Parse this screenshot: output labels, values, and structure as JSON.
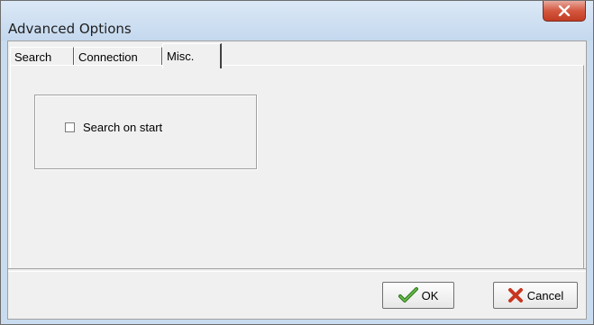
{
  "window": {
    "title": "Advanced Options",
    "close_label": "x"
  },
  "tabs": [
    {
      "label": "Search",
      "active": false
    },
    {
      "label": "Connection",
      "active": false
    },
    {
      "label": "Misc.",
      "active": true
    }
  ],
  "misc": {
    "search_on_start_label": "Search on start",
    "search_on_start_checked": false
  },
  "buttons": {
    "ok_label": "OK",
    "ok_icon": "checkmark-icon",
    "cancel_label": "Cancel",
    "cancel_icon": "x-mark-icon"
  },
  "colors": {
    "checkmark": "#2f7a1f",
    "cancel_x": "#c8361f",
    "close_button": "#c94a33"
  }
}
